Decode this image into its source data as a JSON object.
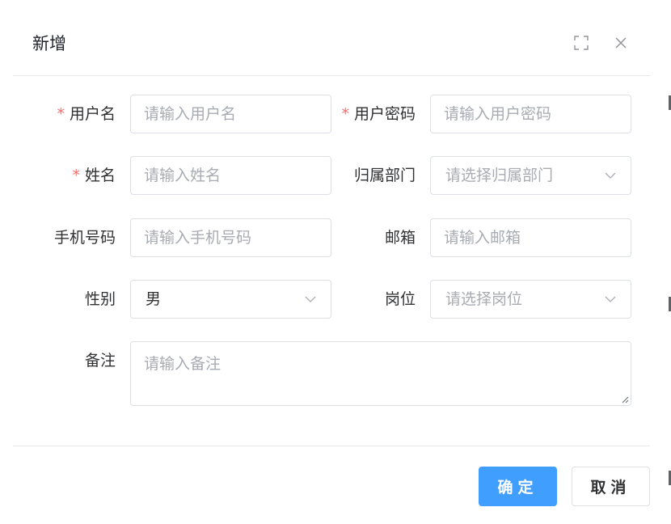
{
  "dialog": {
    "title": "新增",
    "icons": {
      "fullscreen": "fullscreen-icon",
      "close": "close-icon"
    }
  },
  "form": {
    "username": {
      "label": "用户名",
      "required": "*",
      "placeholder": "请输入用户名"
    },
    "password": {
      "label": "用户密码",
      "required": "*",
      "placeholder": "请输入用户密码"
    },
    "nickname": {
      "label": "姓名",
      "required": "*",
      "placeholder": "请输入姓名"
    },
    "department": {
      "label": "归属部门",
      "placeholder": "请选择归属部门"
    },
    "phone": {
      "label": "手机号码",
      "placeholder": "请输入手机号码"
    },
    "email": {
      "label": "邮箱",
      "placeholder": "请输入邮箱"
    },
    "gender": {
      "label": "性别",
      "value": "男"
    },
    "post": {
      "label": "岗位",
      "placeholder": "请选择岗位"
    },
    "remark": {
      "label": "备注",
      "placeholder": "请输入备注"
    }
  },
  "footer": {
    "confirm_label": "确定",
    "cancel_label": "取消"
  },
  "colors": {
    "primary": "#409eff",
    "required": "#f56c6c",
    "border": "#dcdfe6",
    "placeholder": "#a8abb2"
  }
}
